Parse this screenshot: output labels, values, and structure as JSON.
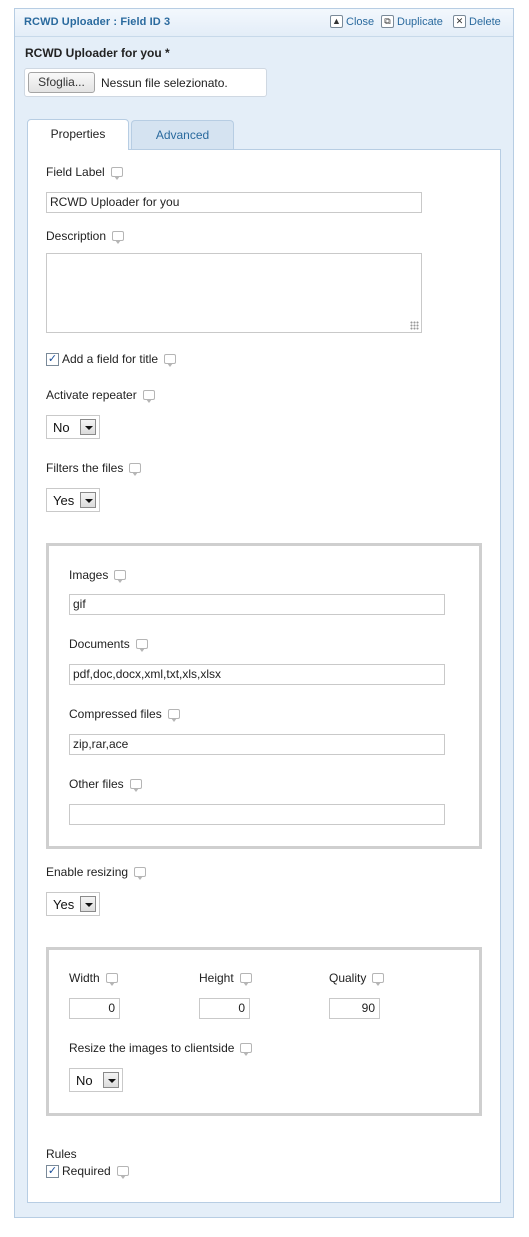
{
  "header": {
    "title": "RCWD Uploader : Field ID 3",
    "close_label": "Close",
    "duplicate_label": "Duplicate",
    "delete_label": "Delete"
  },
  "field_title": "RCWD Uploader for you *",
  "file_picker": {
    "button_label": "Sfoglia...",
    "status": "Nessun file selezionato."
  },
  "tabs": {
    "properties": "Properties",
    "advanced": "Advanced"
  },
  "properties": {
    "field_label": {
      "label": "Field Label",
      "value": "RCWD Uploader for you"
    },
    "description": {
      "label": "Description",
      "value": ""
    },
    "title_field": {
      "label": "Add a field for title",
      "checked": true
    },
    "repeater": {
      "label": "Activate repeater",
      "value": "No"
    },
    "filters": {
      "label": "Filters the files",
      "value": "Yes"
    },
    "file_types": {
      "images": {
        "label": "Images",
        "value": "gif"
      },
      "documents": {
        "label": "Documents",
        "value": "pdf,doc,docx,xml,txt,xls,xlsx"
      },
      "compressed": {
        "label": "Compressed files",
        "value": "zip,rar,ace"
      },
      "other": {
        "label": "Other files",
        "value": ""
      }
    },
    "resizing": {
      "label": "Enable resizing",
      "value": "Yes"
    },
    "resize": {
      "width": {
        "label": "Width",
        "value": "0"
      },
      "height": {
        "label": "Height",
        "value": "0"
      },
      "quality": {
        "label": "Quality",
        "value": "90"
      },
      "clientside": {
        "label": "Resize the images to clientside",
        "value": "No"
      }
    },
    "rules": {
      "label": "Rules",
      "required_label": "Required",
      "required_checked": true
    }
  },
  "icons": {
    "help": "speech-bubble-icon",
    "checkmark": "✓"
  }
}
